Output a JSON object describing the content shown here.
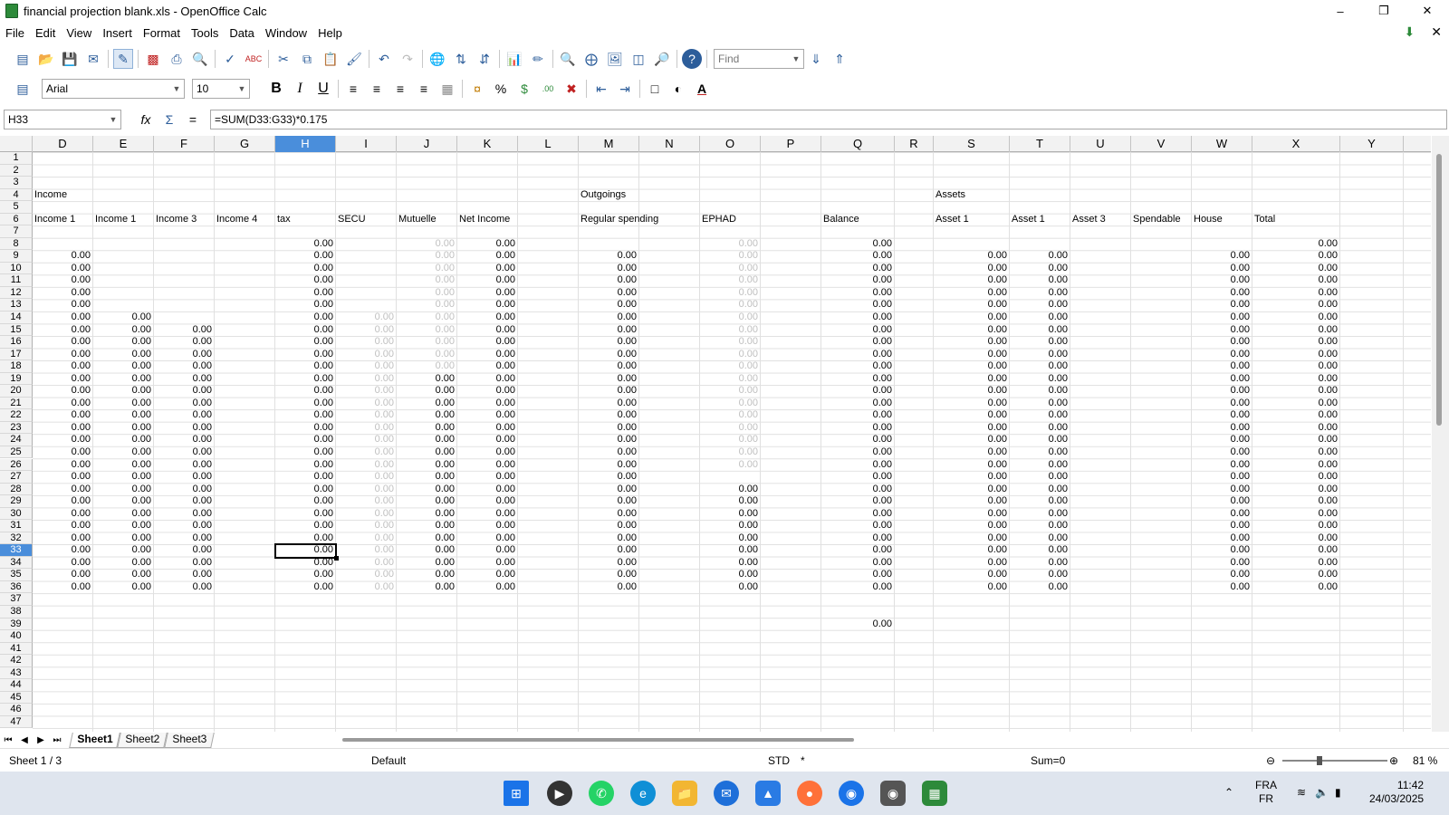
{
  "window": {
    "title": "financial projection blank.xls - OpenOffice Calc"
  },
  "menu": [
    "File",
    "Edit",
    "View",
    "Insert",
    "Format",
    "Tools",
    "Data",
    "Window",
    "Help"
  ],
  "toolbar": {
    "find_placeholder": "Find"
  },
  "format_bar": {
    "font": "Arial",
    "size": "10"
  },
  "formula_bar": {
    "cell_ref": "H33",
    "formula": "=SUM(D33:G33)*0.175"
  },
  "columns": [
    "D",
    "E",
    "F",
    "G",
    "H",
    "I",
    "J",
    "K",
    "L",
    "M",
    "N",
    "O",
    "P",
    "Q",
    "R",
    "S",
    "T",
    "U",
    "V",
    "W",
    "X",
    "Y"
  ],
  "selected_column": "H",
  "selected_row": 33,
  "headers": {
    "income": "Income",
    "outgoings": "Outgoings",
    "assets": "Assets",
    "income1": "Income 1",
    "income1b": "Income 1",
    "income3": "Income 3",
    "income4": "Income 4",
    "tax": "tax",
    "secu": "SECU",
    "mutuelle": "Mutuelle",
    "net_income": "Net Income",
    "regular_spending": "Regular spending",
    "ephad": "EPHAD",
    "balance": "Balance",
    "asset1": "Asset 1",
    "asset1b": "Asset 1",
    "asset3": "Asset 3",
    "spendable": "Spendable",
    "house": "House",
    "total": "Total"
  },
  "zero_value": "0.00",
  "balance_row39": "0.00",
  "sheets": [
    "Sheet1",
    "Sheet2",
    "Sheet3"
  ],
  "active_sheet": "Sheet1",
  "status": {
    "sheet": "Sheet 1 / 3",
    "style": "Default",
    "mode": "STD",
    "modified": "*",
    "sum": "Sum=0",
    "zoom": "81 %"
  },
  "tray": {
    "lang1": "FRA",
    "lang2": "FR",
    "time": "11:42",
    "date": "24/03/2025"
  }
}
